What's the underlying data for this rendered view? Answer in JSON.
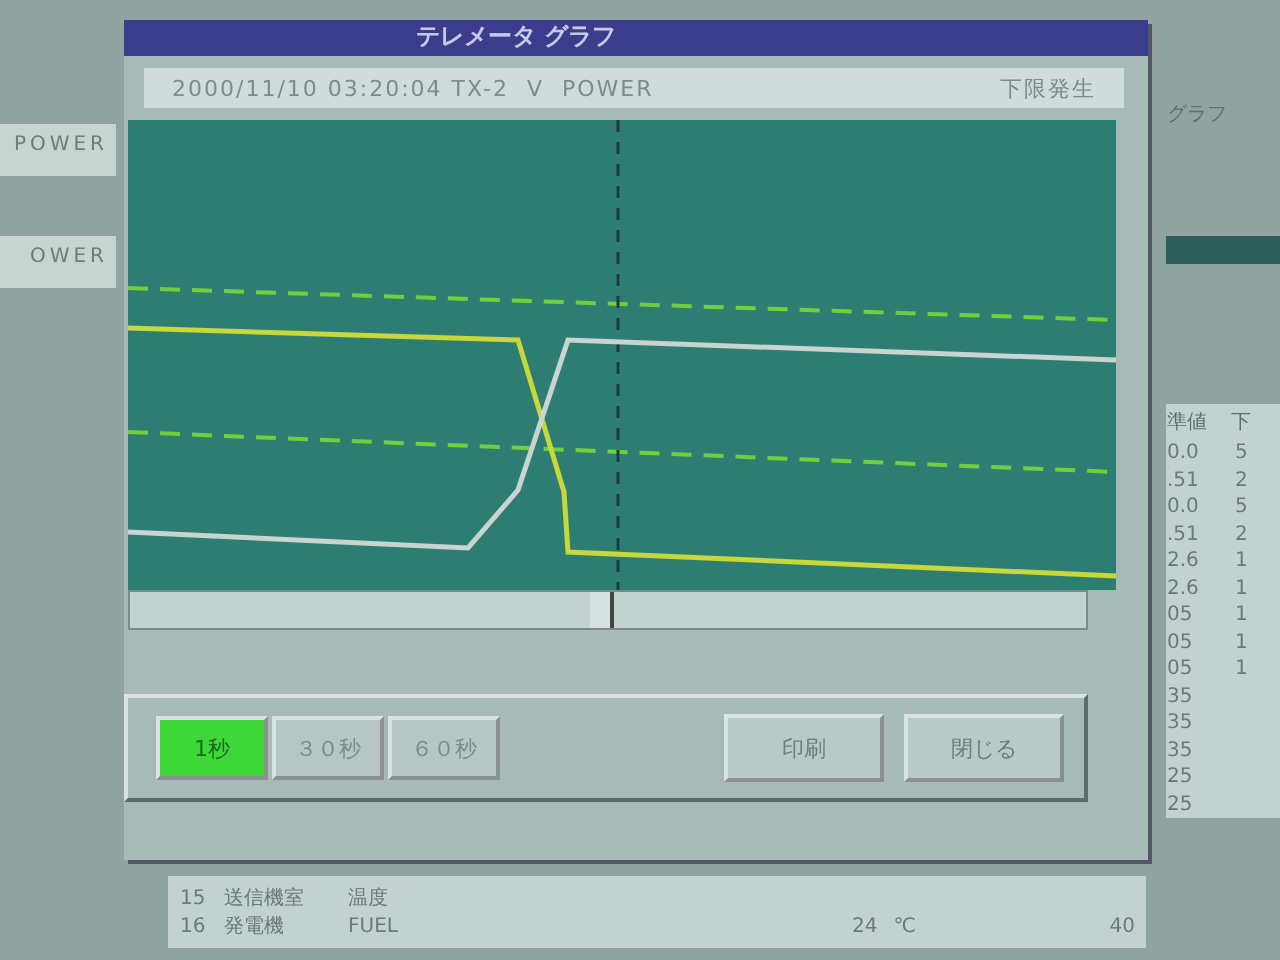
{
  "left_panel": {
    "fields": [
      "POWER",
      "OWER"
    ]
  },
  "right_panel": {
    "title": "グラフ",
    "columns": [
      "準値",
      "下"
    ],
    "rows": [
      {
        "c1": "0.0",
        "c2": "5"
      },
      {
        "c1": ".51",
        "c2": "2"
      },
      {
        "c1": "0.0",
        "c2": "5"
      },
      {
        "c1": ".51",
        "c2": "2"
      },
      {
        "c1": "2.6",
        "c2": "1"
      },
      {
        "c1": "2.6",
        "c2": "1"
      },
      {
        "c1": "05",
        "c2": "1"
      },
      {
        "c1": "05",
        "c2": "1"
      },
      {
        "c1": "05",
        "c2": "1"
      },
      {
        "c1": "35"
      },
      {
        "c1": "35"
      },
      {
        "c1": "35"
      },
      {
        "c1": "25"
      },
      {
        "c1": "25"
      }
    ]
  },
  "bottom_rows": [
    {
      "no": "15",
      "name": "送信機室",
      "item": "温度"
    },
    {
      "no": "16",
      "name": "発電機",
      "item": "FUEL",
      "value": "24",
      "unit": "℃",
      "limit": "40"
    }
  ],
  "window": {
    "title": "テレメータ グラフ"
  },
  "info_bar": {
    "text": "2000/11/10 03:20:04 TX-2  V  POWER",
    "status": "下限発生"
  },
  "period_buttons": [
    {
      "label": "1秒",
      "selected": true
    },
    {
      "label": "３０秒",
      "selected": false
    },
    {
      "label": "６０秒",
      "selected": false
    }
  ],
  "actions": [
    "印刷",
    "閉じる"
  ]
}
